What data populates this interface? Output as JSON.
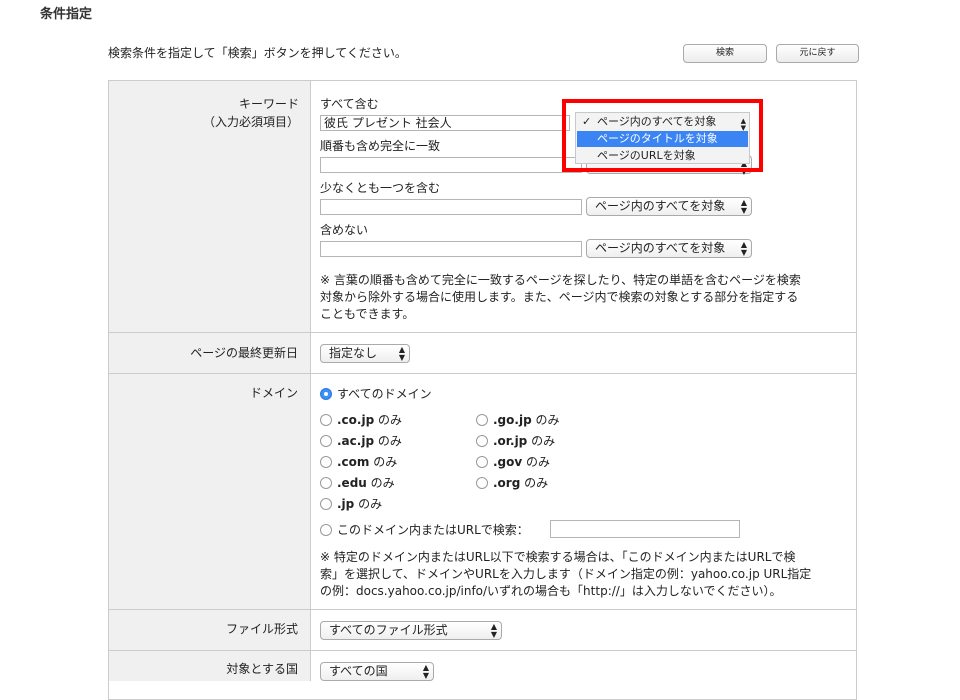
{
  "section_title": "条件指定",
  "instruction": "検索条件を指定して「検索」ボタンを押してください。",
  "buttons": {
    "search": "検索",
    "back": "元に戻す"
  },
  "keyword": {
    "label": "キーワード",
    "sublabel": "（入力必須項目）",
    "all_label": "すべて含む",
    "all_value": "彼氏 プレゼント 社会人",
    "exact_label": "順番も含め完全に一致",
    "exact_value": "",
    "any_label": "少なくとも一つを含む",
    "any_value": "",
    "none_label": "含めない",
    "none_value": "",
    "scope_select": "ページ内のすべてを対象",
    "note_lines": [
      "※ 言葉の順番も含めて完全に一致するページを探したり、特定の単語を含むページを検索",
      "対象から除外する場合に使用します。また、ページ内で検索の対象とする部分を指定する",
      "こともできます。"
    ]
  },
  "dropdown_options": [
    {
      "label": "ページ内のすべてを対象",
      "checked": true
    },
    {
      "label": "ページのタイトルを対象",
      "highlighted": true
    },
    {
      "label": "ページのURLを対象"
    }
  ],
  "last_updated": {
    "label": "ページの最終更新日",
    "value": "指定なし"
  },
  "domain": {
    "label": "ドメイン",
    "all": "すべてのドメイン",
    "col1": [
      {
        "bold": ".co.jp",
        "rest": " のみ"
      },
      {
        "bold": ".ac.jp",
        "rest": " のみ"
      },
      {
        "bold": ".com",
        "rest": " のみ"
      },
      {
        "bold": ".edu",
        "rest": " のみ"
      },
      {
        "bold": ".jp",
        "rest": " のみ"
      }
    ],
    "col2": [
      {
        "bold": ".go.jp",
        "rest": " のみ"
      },
      {
        "bold": ".or.jp",
        "rest": " のみ"
      },
      {
        "bold": ".gov",
        "rest": " のみ"
      },
      {
        "bold": ".org",
        "rest": " のみ"
      }
    ],
    "custom_label": "このドメイン内またはURLで検索：",
    "custom_value": "",
    "note_lines": [
      "※ 特定のドメイン内またはURL以下で検索する場合は、「このドメイン内またはURLで検",
      "索」を選択して、ドメインやURLを入力します（ドメイン指定の例：yahoo.co.jp URL指定",
      "の例：docs.yahoo.co.jp/info/いずれの場合も「http://」は入力しないでください）。"
    ]
  },
  "file_type": {
    "label": "ファイル形式",
    "value": "すべてのファイル形式"
  },
  "country": {
    "label": "対象とする国",
    "value": "すべての国"
  },
  "colors": {
    "accent": "#3b84f4",
    "highlight_box": "#ff0000"
  }
}
